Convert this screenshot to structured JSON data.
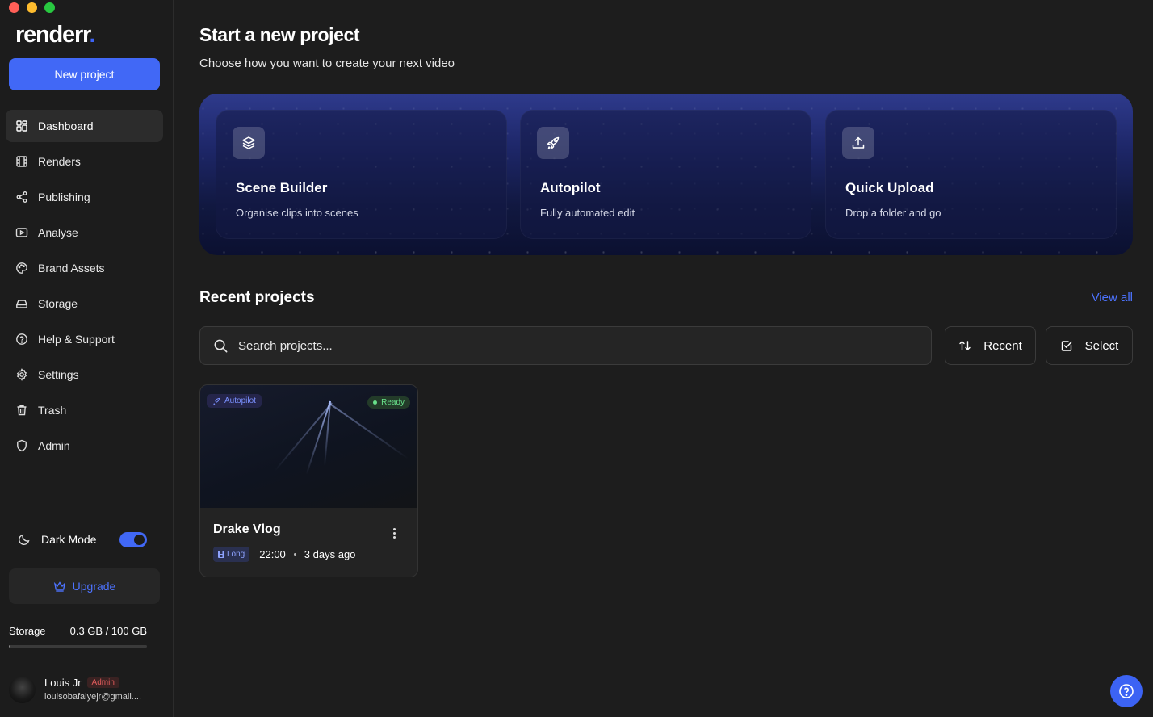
{
  "app": {
    "logo_text": "renderr",
    "logo_dot": ".",
    "window_controls": [
      {
        "name": "close",
        "color": "#ff5f57"
      },
      {
        "name": "minimize",
        "color": "#febc2e"
      },
      {
        "name": "zoom",
        "color": "#28c840"
      }
    ]
  },
  "sidebar": {
    "new_project_label": "New project",
    "items": [
      {
        "label": "Dashboard",
        "icon": "grid-icon",
        "active": true
      },
      {
        "label": "Renders",
        "icon": "film-icon"
      },
      {
        "label": "Publishing",
        "icon": "share-icon"
      },
      {
        "label": "Analyse",
        "icon": "play-square-icon"
      },
      {
        "label": "Brand Assets",
        "icon": "palette-icon"
      },
      {
        "label": "Storage",
        "icon": "hard-drive-icon"
      },
      {
        "label": "Help & Support",
        "icon": "help-circle-icon"
      },
      {
        "label": "Settings",
        "icon": "gear-icon"
      },
      {
        "label": "Trash",
        "icon": "trash-icon"
      },
      {
        "label": "Admin",
        "icon": "shield-icon"
      }
    ],
    "dark_mode_label": "Dark Mode",
    "dark_mode_on": true,
    "upgrade_label": "Upgrade",
    "storage_label": "Storage",
    "storage_value": "0.3 GB / 100 GB",
    "storage_fraction": 0.003,
    "user": {
      "name": "Louis Jr",
      "role": "Admin",
      "email": "louisobafaiyejr@gmail...."
    }
  },
  "main": {
    "title": "Start a new project",
    "subtitle": "Choose how you want to create your next video",
    "create_options": [
      {
        "title": "Scene Builder",
        "description": "Organise clips into scenes",
        "icon": "layers-icon"
      },
      {
        "title": "Autopilot",
        "description": "Fully automated edit",
        "icon": "rocket-icon"
      },
      {
        "title": "Quick Upload",
        "description": "Drop a folder and go",
        "icon": "upload-icon"
      }
    ],
    "recent_title": "Recent projects",
    "view_all_label": "View all",
    "search_placeholder": "Search projects...",
    "sort_label": "Recent",
    "select_label": "Select",
    "projects": [
      {
        "name": "Drake Vlog",
        "mode_tag": "Autopilot",
        "status": "Ready",
        "format": "Long",
        "duration": "22:00",
        "updated": "3 days ago"
      }
    ]
  },
  "colors": {
    "accent": "#4168f6",
    "link": "#4d73ff",
    "ready": "#68e08a",
    "admin_badge": "#e25c5c"
  }
}
